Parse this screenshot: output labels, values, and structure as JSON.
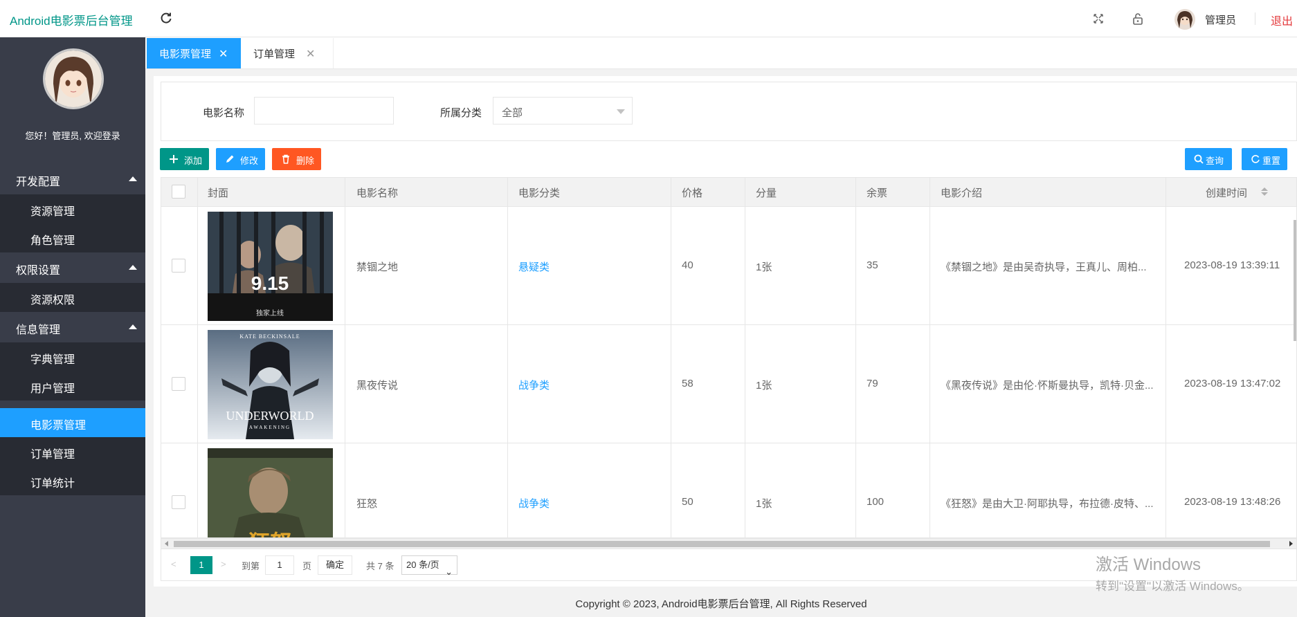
{
  "header": {
    "app_title": "Android电影票后台管理",
    "user_name": "管理员",
    "logout": "退出",
    "icons": [
      "refresh-icon",
      "fullscreen-icon",
      "lock-icon"
    ]
  },
  "sidebar": {
    "welcome": "您好！管理员, 欢迎登录",
    "groups": [
      {
        "label": "开发配置",
        "items": [
          "资源管理",
          "角色管理"
        ]
      },
      {
        "label": "权限设置",
        "items": [
          "资源权限"
        ]
      },
      {
        "label": "信息管理",
        "items": [
          "字典管理",
          "用户管理",
          "电影票管理",
          "订单管理",
          "订单统计"
        ]
      }
    ],
    "active_item": "电影票管理"
  },
  "tabs": [
    {
      "label": "电影票管理",
      "active": true
    },
    {
      "label": "订单管理",
      "active": false
    }
  ],
  "search": {
    "name_label": "电影名称",
    "name_value": "",
    "category_label": "所属分类",
    "category_value": "全部"
  },
  "toolbar": {
    "add": "添加",
    "edit": "修改",
    "delete": "删除",
    "query": "查询",
    "reset": "重置"
  },
  "table": {
    "columns": [
      "封面",
      "电影名称",
      "电影分类",
      "价格",
      "分量",
      "余票",
      "电影介绍",
      "创建时间"
    ],
    "rows": [
      {
        "name": "禁锢之地",
        "category": "悬疑类",
        "price": "40",
        "unit": "1张",
        "stock": "35",
        "intro": "《禁锢之地》是由吴奇执导，王真儿、周柏...",
        "created": "2023-08-19 13:39:11",
        "poster_text": "9.15",
        "poster_sub": "独家上线"
      },
      {
        "name": "黑夜传说",
        "category": "战争类",
        "price": "58",
        "unit": "1张",
        "stock": "79",
        "intro": "《黑夜传说》是由伦·怀斯曼执导，凯特·贝金...",
        "created": "2023-08-19 13:47:02",
        "poster_top": "KATE BECKINSALE",
        "poster_text": "UNDERWORLD",
        "poster_sub": "AWAKENING"
      },
      {
        "name": "狂怒",
        "category": "战争类",
        "price": "50",
        "unit": "1张",
        "stock": "100",
        "intro": "《狂怒》是由大卫·阿耶执导，布拉德·皮特、...",
        "created": "2023-08-19 13:48:26",
        "poster_text": "狂怒"
      }
    ]
  },
  "pager": {
    "current": "1",
    "goto_label": "到第",
    "goto_value": "1",
    "page_unit": "页",
    "confirm": "确定",
    "total": "共 7 条",
    "page_size": "20 条/页"
  },
  "watermark": {
    "line1": "激活 Windows",
    "line2": "转到\"设置\"以激活 Windows。"
  },
  "footer": "Copyright © 2023, Android电影票后台管理, All Rights Reserved",
  "colors": {
    "sidebar_bg": "#393d49",
    "sidebar_sub_bg": "#282b33",
    "accent_blue": "#1e9fff",
    "accent_green": "#009688",
    "accent_orange": "#ff5722",
    "logout_red": "#e4393c"
  }
}
